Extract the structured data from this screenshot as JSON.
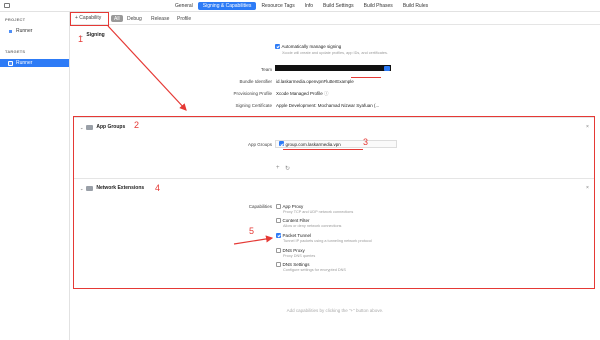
{
  "tabs": [
    "General",
    "Signing & Capabilities",
    "Resource Tags",
    "Info",
    "Build Settings",
    "Build Phases",
    "Build Rules"
  ],
  "sidebar": {
    "project_heading": "PROJECT",
    "project_item": "Runner",
    "targets_heading": "TARGETS",
    "target_item": "Runner"
  },
  "subbar": {
    "add_capability": "+ Capability",
    "configs": [
      "All",
      "Debug",
      "Release",
      "Profile"
    ]
  },
  "signing": {
    "title": "Signing",
    "auto_manage": "Automatically manage signing",
    "auto_note": "Xcode will create and update profiles, app IDs, and certificates.",
    "team_label": "Team",
    "bundle_label": "Bundle Identifier",
    "bundle_value": "id.laskarmedia.openvpnFlutterExample",
    "profile_label": "Provisioning Profile",
    "profile_value": "Xcode Managed Profile",
    "cert_label": "Signing Certificate",
    "cert_value": "Apple Development: Mochamad Nizwar Syafuan (..."
  },
  "app_groups": {
    "title": "App Groups",
    "label": "App Groups",
    "value": "group.com.laskarmedia.vpn"
  },
  "network_ext": {
    "title": "Network Extensions",
    "label": "Capabilities",
    "options": [
      {
        "name": "App Proxy",
        "note": "Proxy TCP and UDP network connections",
        "checked": false
      },
      {
        "name": "Content Filter",
        "note": "Allow or deny network connections",
        "checked": false
      },
      {
        "name": "Packet Tunnel",
        "note": "Tunnel IP packets using a tunneling network protocol",
        "checked": true
      },
      {
        "name": "DNS Proxy",
        "note": "Proxy DNS queries",
        "checked": false
      },
      {
        "name": "DNS Settings",
        "note": "Configure settings for encrypted DNS",
        "checked": false
      }
    ]
  },
  "footer": "Add capabilities by clicking the \"+\" button above.",
  "annotations": [
    "1",
    "2",
    "3",
    "4",
    "5"
  ],
  "colors": {
    "accent": "#2d7bf6",
    "annotation": "#e53935"
  }
}
